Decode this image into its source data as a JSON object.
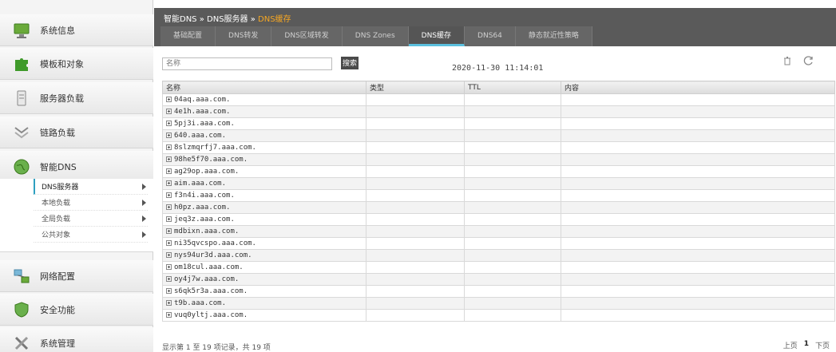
{
  "sidebar": {
    "items": [
      {
        "label": "系统信息",
        "icon": "monitor-icon"
      },
      {
        "label": "模板和对象",
        "icon": "puzzle-icon"
      },
      {
        "label": "服务器负载",
        "icon": "server-icon"
      },
      {
        "label": "链路负载",
        "icon": "link-icon"
      },
      {
        "label": "智能DNS",
        "icon": "globe-icon"
      },
      {
        "label": "网络配置",
        "icon": "network-icon"
      },
      {
        "label": "安全功能",
        "icon": "shield-icon"
      },
      {
        "label": "系统管理",
        "icon": "tools-icon"
      }
    ],
    "submenu": [
      {
        "label": "DNS服务器",
        "active": true
      },
      {
        "label": "本地负载"
      },
      {
        "label": "全局负载"
      },
      {
        "label": "公共对象"
      }
    ]
  },
  "header": {
    "breadcrumb": {
      "part1": "智能DNS",
      "sep": " » ",
      "part2": "DNS服务器",
      "current": "DNS缓存"
    },
    "tabs": [
      {
        "label": "基础配置"
      },
      {
        "label": "DNS转发"
      },
      {
        "label": "DNS区域转发"
      },
      {
        "label": "DNS Zones"
      },
      {
        "label": "DNS缓存",
        "active": true
      },
      {
        "label": "DNS64"
      },
      {
        "label": "静态就近性策略"
      }
    ]
  },
  "toolbar": {
    "search_placeholder": "名称",
    "search_label": "搜索",
    "timestamp": "2020-11-30 11:14:01"
  },
  "table": {
    "columns": [
      "名称",
      "类型",
      "TTL",
      "内容"
    ],
    "rows": [
      "04aq.aaa.com.",
      "4e1h.aaa.com.",
      "5pj3i.aaa.com.",
      "640.aaa.com.",
      "8slzmqrfj7.aaa.com.",
      "98he5f70.aaa.com.",
      "ag29op.aaa.com.",
      "aim.aaa.com.",
      "f3n4i.aaa.com.",
      "h0pz.aaa.com.",
      "jeq3z.aaa.com.",
      "mdbixn.aaa.com.",
      "ni35qvcspo.aaa.com.",
      "nys94ur3d.aaa.com.",
      "om18cul.aaa.com.",
      "oy4j7w.aaa.com.",
      "s6qk5r3a.aaa.com.",
      "t9b.aaa.com.",
      "vuq0yltj.aaa.com."
    ]
  },
  "footer": {
    "info": "显示第 1 至 19 项记录，共 19 项",
    "prev": "上页",
    "page": "1",
    "next": "下页"
  },
  "colors": {
    "accent": "#5bc0de",
    "breadcrumb_current": "#f5a623",
    "header_bg": "#5a5a5a"
  }
}
